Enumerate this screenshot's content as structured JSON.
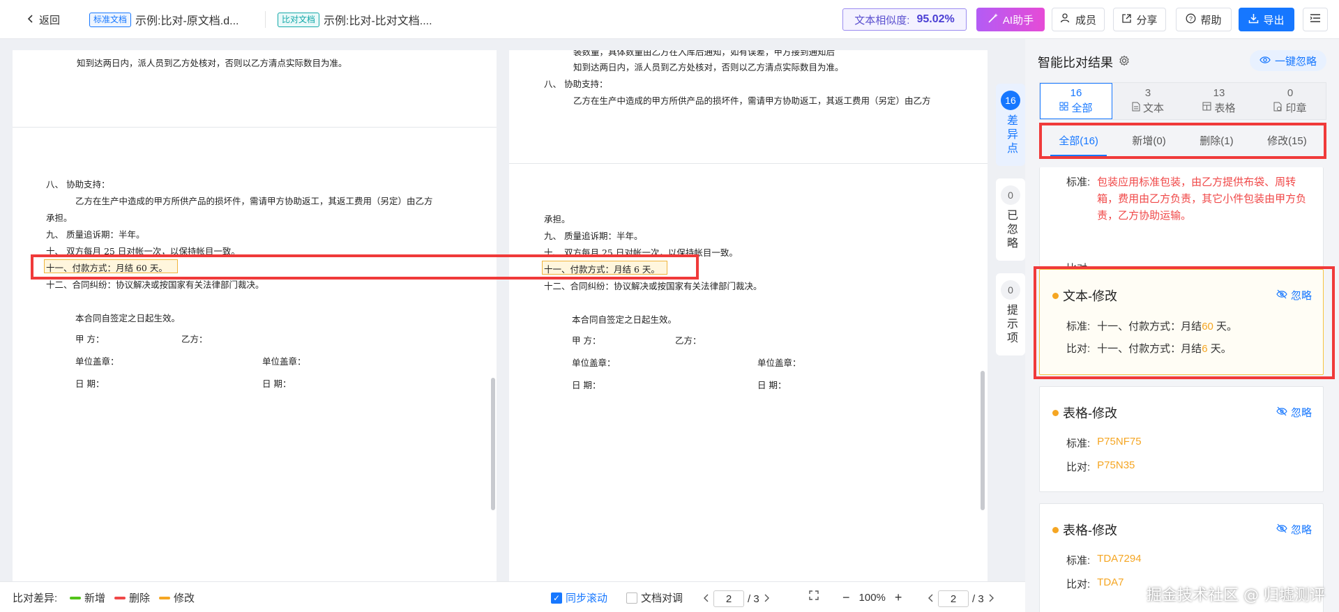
{
  "header": {
    "back_label": "返回",
    "standard_tag": "标准文档",
    "standard_name": "示例:比对-原文档.d...",
    "compare_tag": "比对文档",
    "compare_name": "示例:比对-比对文档....",
    "similarity_label": "文本相似度:",
    "similarity_value": "95.02%",
    "ai_label": "AI助手",
    "members_label": "成员",
    "share_label": "分享",
    "help_label": "帮助",
    "export_label": "导出"
  },
  "left_doc": {
    "lines": [
      "知到达两日内，派人员到乙方处核对，否则以乙方清点实际数目为准。",
      "八、    协助支持：",
      "乙方在生产中造成的甲方所供产品的损坏件，需请甲方协助返工，其返工费用（另定）由乙方",
      "承担。",
      "九、    质量追诉期：半年。",
      "十、    双方每月 25 日对帐一次，以保持帐目一致。",
      "十一、付款方式：月结 60 天。",
      "十二、合同纠纷：协议解决或按国家有关法律部门裁决。",
      "本合同自签定之日起生效。",
      "甲      方：",
      "乙方：",
      "单位盖章：",
      "单位盖章：",
      "日      期：",
      "日      期："
    ]
  },
  "right_doc": {
    "lines": [
      "装数量，具体数量由乙方在入库后通知，如有误差，甲方接到通知后",
      "知到达两日内，派人员到乙方处核对，否则以乙方清点实际数目为准。",
      "八、    协助支持：",
      "乙方在生产中造成的甲方所供产品的损坏件，需请甲方协助返工，其返工费用（另定）由乙方",
      "承担。",
      "九、    质量追诉期：半年。",
      "十、    双方每月 25 日对帐一次，以保持帐目一致。",
      "十一、付款方式：月结 6 天。",
      "十二、合同纠纷：协议解决或按国家有关法律部门裁决。",
      "本合同自签定之日起生效。",
      "甲      方：",
      "乙方：",
      "单位盖章：",
      "单位盖章：",
      "日      期：",
      "日      期："
    ]
  },
  "markers": {
    "diff_count": "16",
    "diff_label": "差异点",
    "ignored_count": "0",
    "ignored_label": "已忽略",
    "hint_count": "0",
    "hint_label": "提示项"
  },
  "panel": {
    "title": "智能比对结果",
    "ignore_all": "一键忽略",
    "type_tabs": [
      {
        "count": "16",
        "label": "全部"
      },
      {
        "count": "3",
        "label": "文本"
      },
      {
        "count": "13",
        "label": "表格"
      },
      {
        "count": "0",
        "label": "印章"
      }
    ],
    "sub_tabs": [
      "全部(16)",
      "新增(0)",
      "删除(1)",
      "修改(15)"
    ],
    "card0": {
      "std_label": "标准:",
      "std_value": "包装应用标准包装，由乙方提供布袋、周转箱，费用由乙方负责，其它小件包装由甲方负责，乙方协助运输。",
      "cmp_label": "比对:"
    },
    "card1": {
      "title": "文本-修改",
      "ignore": "忽略",
      "std_label": "标准:",
      "std_pre": "十一、付款方式：月结",
      "std_hl": "60",
      "std_post": " 天。",
      "cmp_label": "比对:",
      "cmp_pre": "十一、付款方式：月结",
      "cmp_hl": "6",
      "cmp_post": " 天。"
    },
    "card2": {
      "title": "表格-修改",
      "ignore": "忽略",
      "std_label": "标准:",
      "std_value": "P75NF75",
      "cmp_label": "比对:",
      "cmp_value": "P75N35"
    },
    "card3": {
      "title": "表格-修改",
      "ignore": "忽略",
      "std_label": "标准:",
      "std_value": "TDA7294",
      "cmp_label": "比对:",
      "cmp_value": "TDA7"
    }
  },
  "bottom": {
    "legend_title": "比对差异:",
    "legend_add": "新增",
    "legend_delete": "删除",
    "legend_modify": "修改",
    "colors": {
      "add": "#52c41a",
      "delete": "#f04848",
      "modify": "#f5a623"
    },
    "sync_scroll": "同步滚动",
    "doc_align": "文档对调",
    "left_page": "2",
    "left_total": "/ 3",
    "zoom": "100%",
    "right_page": "2",
    "right_total": "/ 3"
  },
  "watermark": "掘金技术社区 @ 归墟测评"
}
